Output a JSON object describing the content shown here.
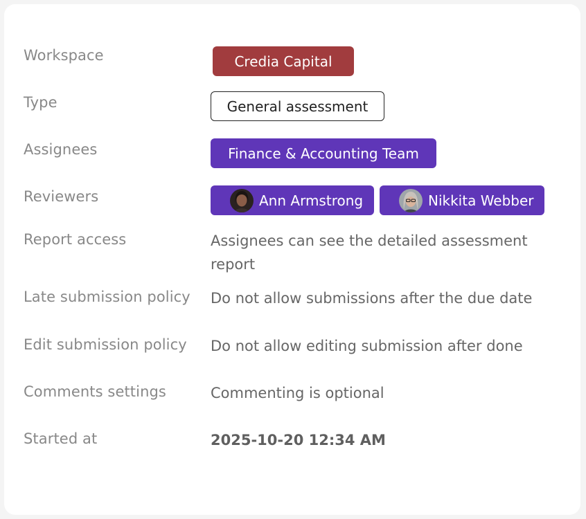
{
  "details": {
    "workspace": {
      "label": "Workspace",
      "value": "Credia Capital",
      "color": "#a13c3e"
    },
    "type": {
      "label": "Type",
      "value": "General assessment"
    },
    "assignees": {
      "label": "Assignees",
      "value": "Finance & Accounting Team",
      "color": "#5f36b8"
    },
    "reviewers": {
      "label": "Reviewers",
      "people": [
        {
          "name": "Ann Armstrong",
          "avatar": "person-avatar"
        },
        {
          "name": "Nikkita Webber",
          "avatar": "person-avatar"
        }
      ]
    },
    "report_access": {
      "label": "Report access",
      "value": "Assignees can see the detailed assessment report"
    },
    "late_submission": {
      "label": "Late submission policy",
      "value": "Do not allow submissions after the due date"
    },
    "edit_submission": {
      "label": "Edit submission policy",
      "value": "Do not allow editing submission after done"
    },
    "comments": {
      "label": "Comments settings",
      "value": "Commenting is optional"
    },
    "started_at": {
      "label": "Started at",
      "value": "2025-10-20 12:34 AM"
    }
  }
}
